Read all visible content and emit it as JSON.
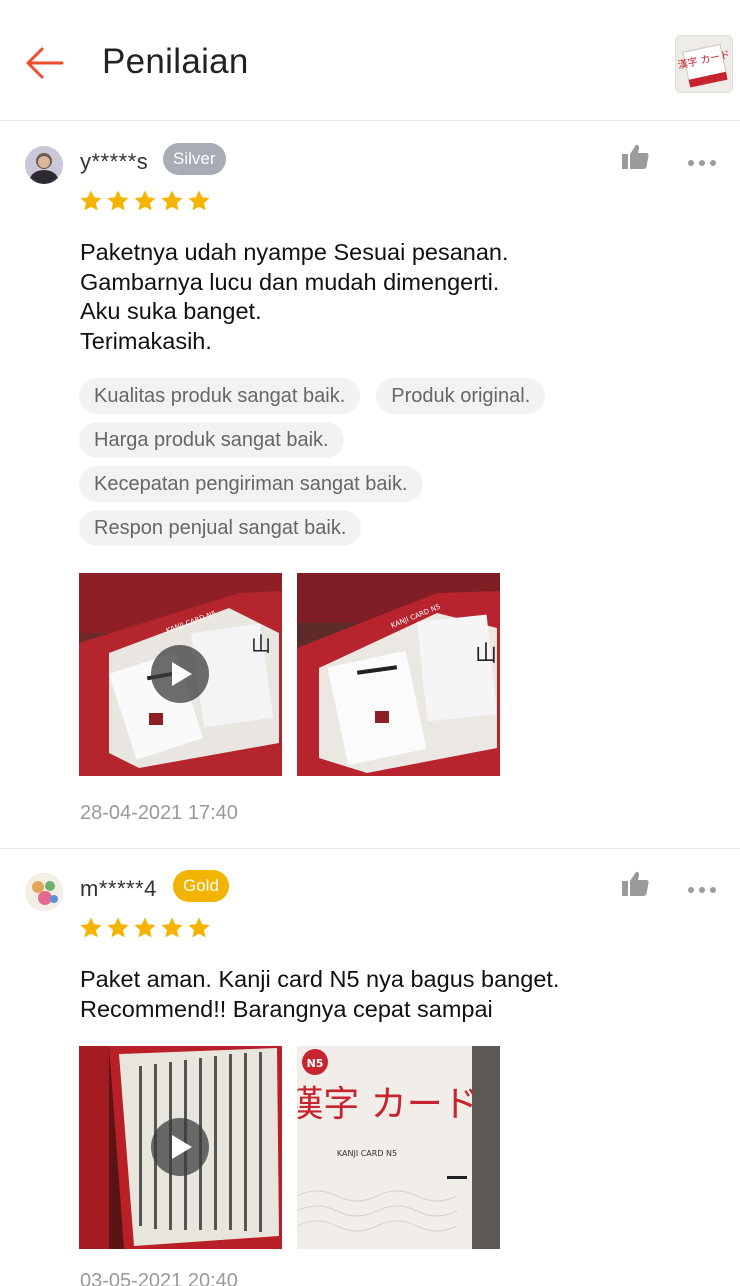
{
  "header": {
    "title": "Penilaian",
    "accent_color": "#ee4d2d",
    "product_thumb_text": "漢字 カード"
  },
  "reviews": [
    {
      "username": "y*****s",
      "badge": "Silver",
      "badge_color": "#a8adb5",
      "rating": 5,
      "text": "Paketnya udah nyampe Sesuai pesanan.\nGambarnya lucu dan mudah dimengerti.\nAku suka banget.\nTerimakasih.",
      "tags": [
        [
          "Kualitas produk sangat baik.",
          "Produk original."
        ],
        [
          "Harga produk sangat baik."
        ],
        [
          "Kecepatan pengiriman sangat baik."
        ],
        [
          "Respon penjual sangat baik."
        ]
      ],
      "media": [
        {
          "type": "video",
          "card_label": "KANJI CARD N5",
          "kanji": "山"
        },
        {
          "type": "image",
          "card_label": "KANJI CARD N5",
          "kanji": "山"
        }
      ],
      "timestamp": "28-04-2021 17:40"
    },
    {
      "username": "m*****4",
      "badge": "Gold",
      "badge_color": "#f2b400",
      "rating": 5,
      "text": "Paket aman. Kanji card N5 nya bagus banget.\nRecommend!! Barangnya cepat sampai",
      "tags": [],
      "media": [
        {
          "type": "video",
          "card_label": "",
          "kanji": ""
        },
        {
          "type": "image",
          "card_label": "KANJI CARD N5",
          "kanji": "漢字 カード",
          "level": "N5"
        }
      ],
      "timestamp": "03-05-2021 20:40"
    }
  ],
  "star_color": "#f5b400"
}
